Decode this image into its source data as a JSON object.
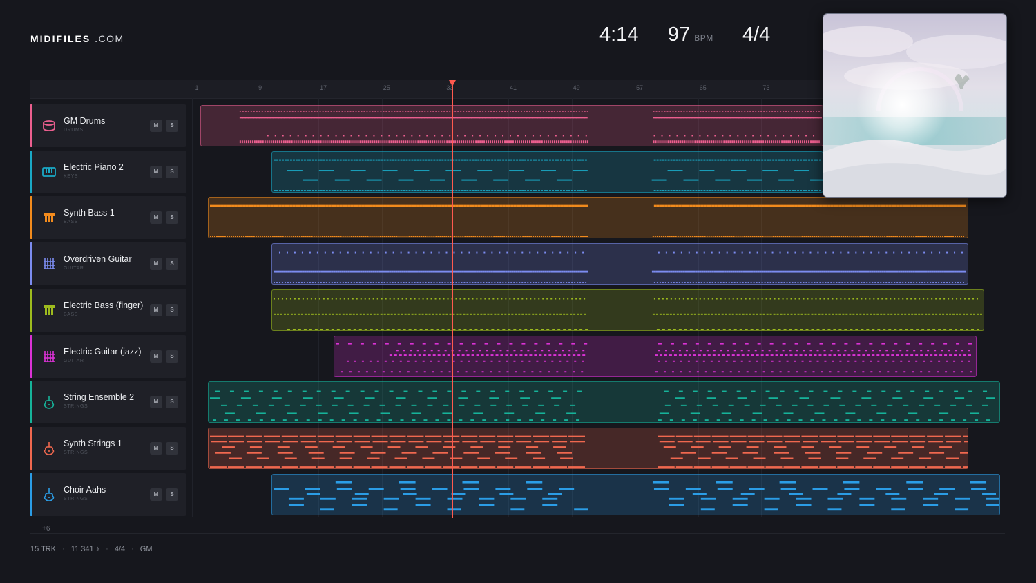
{
  "brand": {
    "bold": "MIDIFILES",
    "light": ".COM"
  },
  "transport": {
    "time": "4:14",
    "bpm": "97",
    "bpm_unit": "BPM",
    "time_signature": "4/4"
  },
  "ruler": {
    "bars": [
      "1",
      "9",
      "17",
      "25",
      "33",
      "41",
      "49",
      "57",
      "65",
      "73"
    ]
  },
  "tracks": [
    {
      "name": "GM Drums",
      "category": "DRUMS",
      "color": "#ec5f8f",
      "icon": "drum-icon",
      "mute": "M",
      "solo": "S"
    },
    {
      "name": "Electric Piano 2",
      "category": "KEYS",
      "color": "#1aa9c6",
      "icon": "piano-icon",
      "mute": "M",
      "solo": "S"
    },
    {
      "name": "Synth Bass 1",
      "category": "BASS",
      "color": "#f28b1d",
      "icon": "bass-icon",
      "mute": "M",
      "solo": "S"
    },
    {
      "name": "Overdriven Guitar",
      "category": "GUITAR",
      "color": "#7c8cf0",
      "icon": "guitar-grid-icon",
      "mute": "M",
      "solo": "S"
    },
    {
      "name": "Electric Bass (finger)",
      "category": "BASS",
      "color": "#9dbb1e",
      "icon": "bass-icon",
      "mute": "M",
      "solo": "S"
    },
    {
      "name": "Electric Guitar (jazz)",
      "category": "GUITAR",
      "color": "#db32d6",
      "icon": "guitar-grid-icon",
      "mute": "M",
      "solo": "S"
    },
    {
      "name": "String Ensemble 2",
      "category": "STRINGS",
      "color": "#16b39a",
      "icon": "violin-icon",
      "mute": "M",
      "solo": "S"
    },
    {
      "name": "Synth Strings 1",
      "category": "STRINGS",
      "color": "#f0684f",
      "icon": "violin-icon",
      "mute": "M",
      "solo": "S"
    },
    {
      "name": "Choir Aahs",
      "category": "STRINGS",
      "color": "#2b9de6",
      "icon": "violin-icon",
      "mute": "M",
      "solo": "S"
    }
  ],
  "more_tracks": "+6",
  "footer": {
    "tracks": "15 TRK",
    "notes": "11 341 ♪",
    "signature": "4/4",
    "standard": "GM"
  },
  "playhead_bar": 33
}
